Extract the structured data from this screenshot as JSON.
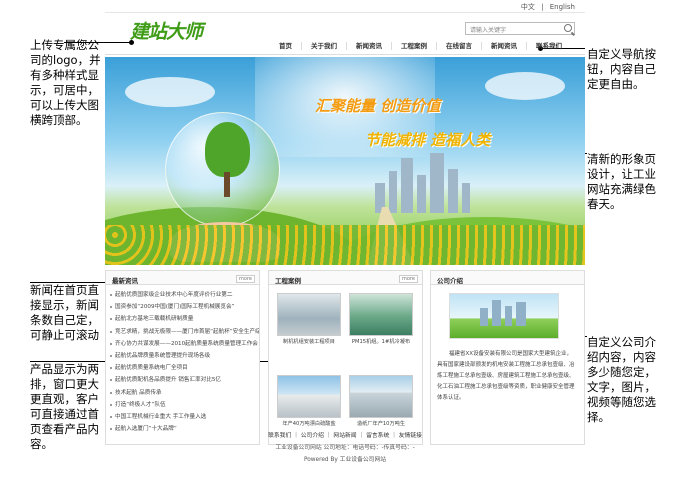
{
  "annotations": {
    "logo_note": "上传专属您公司的logo，并有多种样式显示，可居中，可以上传大图横跨顶部。",
    "nav_note": "自定义导航按钮，内容自己定更自由。",
    "banner_note": "清新的形象页设计，让工业网站充满绿色春天。",
    "news_note": "新闻在首页直接显示，新闻条数自己定，可静止可滚动",
    "product_note": "产品显示为两排，窗口更大更直观，客户可直接通过首页查看产品内容。",
    "about_note": "自定义公司介绍内容，内容多少随您定，文字，图片，视频等随您选择。"
  },
  "header": {
    "lang_cn": "中文",
    "lang_sep": "|",
    "lang_en": "English",
    "logo_text": "建站大师",
    "search_placeholder": "请输入关键字"
  },
  "nav": [
    "首页",
    "关于我们",
    "新闻资讯",
    "工程案例",
    "在线留言",
    "新闻资讯",
    "联系我们"
  ],
  "banner": {
    "slogan1": "汇聚能量 创造价值",
    "slogan2": "节能减排 造福人类"
  },
  "news": {
    "title": "最新资讯",
    "more": "more",
    "items": [
      "起航优质国家级企业技术中心年度评价行业第二",
      "国资参加“2009中国(厦门)国际工程机械展览会”",
      "起航北方基地三载载机研制质量",
      "竞艺求精，挑战无极限——厦门市首届“起航杯”安全生产综合救援技能大赛暗拼有",
      "齐心协力共谋发展——2010起航质量系统质量管理工作会",
      "起航优品牌质量系统管理提升现场各级",
      "起航优质质量系统电厂全项目 ",
      "起航优质配机各品质提升 销售汇率对比5亿",
      "技术起航 品质传承",
      "打造“终极人才”队伍",
      "中国工程机械行业重大 手工作量入选",
      "起航入选厦门“十大品牌”"
    ]
  },
  "cases": {
    "title": "工程案例",
    "more": "more",
    "items": [
      "制机机组安装工程项目",
      "PM15机组。1#机冷凝布",
      "年产40万吨漂白硫酸盐",
      "造纸厂年产10万吨生"
    ]
  },
  "about": {
    "title": "公司介绍",
    "text": "福建省XX设备安装有限公司是国家大型建筑企业，具有国家建设部颁发的机电安装工程施工总承包壹级、冶炼工程施工总承包壹级、房屋建筑工程施工总承包壹级、化工石油工程施工总承包壹级等资质，职业健康安全管理体系认证。"
  },
  "footer": {
    "links": "联系我们 ｜ 公司介绍 ｜ 网站新闻 ｜ 留言系统 ｜ 友情链接",
    "info": "工业设备公司网站 公司地址：电话号码：-传真号码：-",
    "powered": "Powered By 工业设备公司网站"
  }
}
